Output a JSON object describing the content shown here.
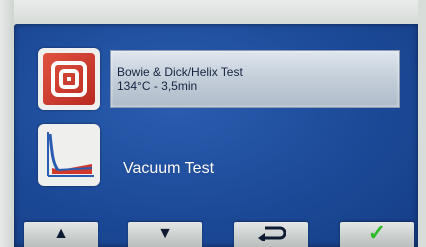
{
  "program_list": {
    "items": [
      {
        "icon": "concentric-squares-icon",
        "line1": "Bowie & Dick/Helix Test",
        "line2": "134°C - 3,5min",
        "selected": true
      },
      {
        "icon": "vacuum-graph-icon",
        "line1": "Vacuum Test",
        "selected": false
      }
    ]
  },
  "nav_buttons": [
    {
      "name": "up",
      "glyph": "▲"
    },
    {
      "name": "down",
      "glyph": "▼"
    },
    {
      "name": "back",
      "glyph": "⮌"
    },
    {
      "name": "confirm",
      "glyph": "✓"
    }
  ],
  "colors": {
    "screen_background": "#1c4a98",
    "selection_highlight": "#c6d0db",
    "icon_red": "#d0382c",
    "confirm_green": "#2fbb2b"
  }
}
